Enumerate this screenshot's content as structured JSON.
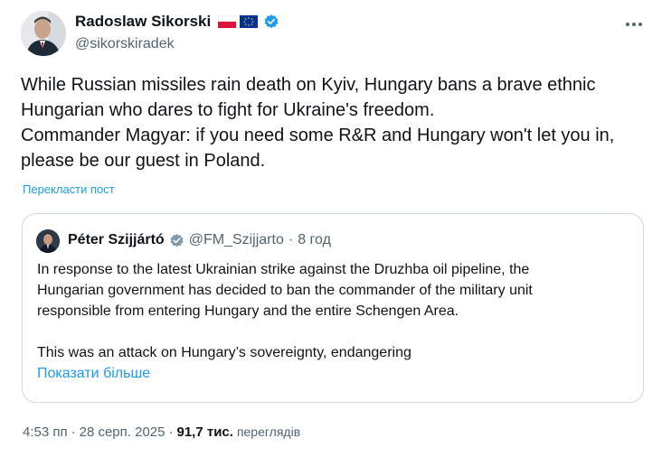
{
  "author": {
    "name": "Radoslaw Sikorski",
    "handle": "@sikorskiradek",
    "flags": [
      "poland-flag-icon",
      "eu-flag-icon"
    ],
    "verified_icon": "verified-badge-icon"
  },
  "more_icon": "more-options-icon",
  "tweet": {
    "lines": [
      "While Russian missiles rain death on Kyiv, Hungary bans a brave ethnic",
      "Hungarian who dares to fight for Ukraine's freedom.",
      "Commander Magyar: if you need some R&R and Hungary won't let you in,",
      "please be our guest in Poland."
    ],
    "translate_label": "Перекласти пост"
  },
  "quote": {
    "name": "Péter Szijjártó",
    "handle": "@FM_Szijjarto",
    "separator": "·",
    "time": "8 год",
    "lines": [
      "In response to the latest Ukrainian strike against the Druzhba oil pipeline, the",
      "Hungarian government has decided to ban the commander of the military unit",
      "responsible from entering Hungary and the entire Schengen Area."
    ],
    "line2": "This was an attack on Hungary’s sovereignty, endangering",
    "show_more": "Показати більше"
  },
  "footer": {
    "time": "4:53 пп",
    "separator": "·",
    "date": "28 серп. 2025",
    "separator2": "·",
    "views_count": "91,7 тис.",
    "views_label": "переглядів"
  },
  "colors": {
    "accent": "#1d9bf0",
    "text": "#0f1419",
    "muted": "#536471",
    "border": "#cfd9de"
  }
}
